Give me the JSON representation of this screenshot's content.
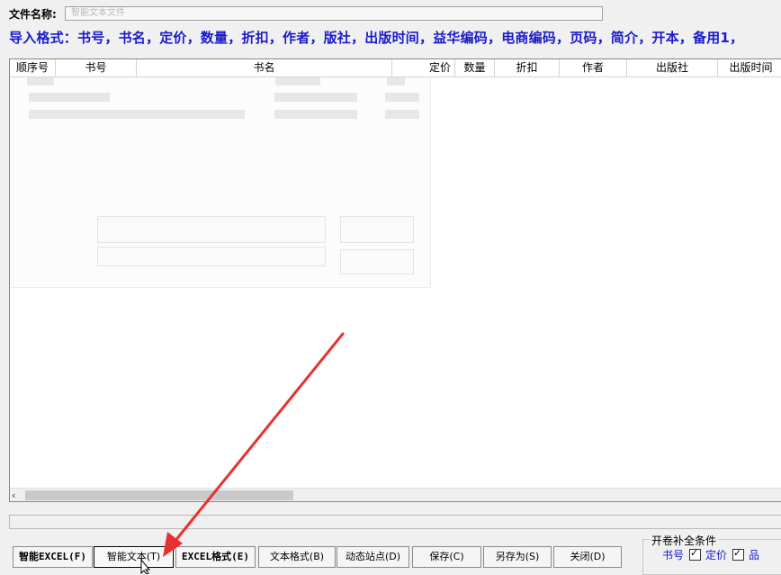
{
  "file": {
    "label": "文件名称:",
    "value": "智能文本文件"
  },
  "format_line": "导入格式：书号，书名，定价，数量，折扣，作者，版社，出版时间，益华编码，电商编码，页码，简介，开本，备用1，",
  "columns": [
    "顺序号",
    "书号",
    "书名",
    "定价",
    "数量",
    "折扣",
    "作者",
    "出版社",
    "出版时间"
  ],
  "buttons": {
    "smart_excel": "智能EXCEL(F)",
    "smart_text": "智能文本(T)",
    "excel_format": "EXCEL格式(E)",
    "text_format": "文本格式(B)",
    "dynamic_site": "动态站点(D)",
    "save": "保存(C)",
    "save_as": "另存为(S)",
    "close": "关闭(D)"
  },
  "group": {
    "title": "开卷补全条件",
    "items": [
      {
        "label": "书号",
        "checked": true
      },
      {
        "label": "定价",
        "checked": true
      },
      {
        "label": "品",
        "checked": false
      }
    ]
  },
  "colors": {
    "blue_text": "#1a1acc",
    "annotation_arrow": "#e8312f"
  }
}
